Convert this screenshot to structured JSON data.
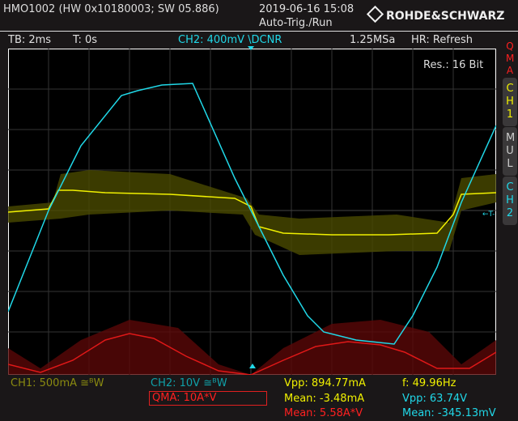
{
  "header": {
    "device": "HMO1002 (HW 0x10180003; SW 05.886)",
    "datetime": "2019-06-16 15:08",
    "trigger_status": "Auto-Trig./Run",
    "brand": "ROHDE&SCHWARZ"
  },
  "statusbar": {
    "timebase": "TB: 2ms",
    "trigger_time": "T: 0s",
    "trigger_source": "CH2: 400mV \\DCNR",
    "sample_rate": "1.25MSa",
    "hr_mode": "HR: Refresh"
  },
  "screen": {
    "resolution": "Res.: 16 Bit",
    "trigger_marker": "←T-"
  },
  "side_tabs": [
    {
      "label": "QMA",
      "color": "#ff2020"
    },
    {
      "label": "CH1",
      "color": "#f0f000"
    },
    {
      "label": "MUL",
      "color": "#cccccc"
    },
    {
      "label": "CH2",
      "color": "#20d8e8"
    }
  ],
  "bottom": {
    "ch1": "CH1: 500mA ≅ᴮW",
    "ch2": "CH2: 10V ≅ᴮW",
    "qma": "QMA: 10A*V",
    "ch1_vpp": "Vpp: 894.77mA",
    "ch1_mean": "Mean: -3.48mA",
    "qma_mean": "Mean: 5.58A*V",
    "freq": "f: 49.96Hz",
    "ch2_vpp": "Vpp: 63.74V",
    "ch2_mean": "Mean: -345.13mV"
  },
  "colors": {
    "ch1": "#f0f000",
    "ch2": "#20d8e8",
    "qma": "#ff2020"
  }
}
